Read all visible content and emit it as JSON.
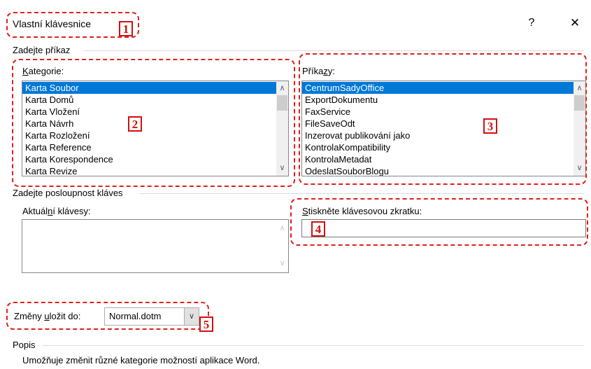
{
  "window": {
    "title": "Vlastní klávesnice",
    "help_label": "?",
    "close_label": "✕"
  },
  "annotations": [
    "1",
    "2",
    "3",
    "4",
    "5"
  ],
  "commands_section": {
    "heading": "Zadejte příkaz",
    "categories_label_pre": "",
    "categories_label_u": "K",
    "categories_label_post": "ategorie:",
    "categories": [
      "Karta Soubor",
      "Karta Domů",
      "Karta Vložení",
      "Karta Návrh",
      "Karta Rozložení",
      "Karta Reference",
      "Karta Korespondence",
      "Karta Revize"
    ],
    "categories_selected": 0,
    "commands_label_pre": "Příka",
    "commands_label_u": "z",
    "commands_label_post": "y:",
    "commands": [
      "CentrumSadyOffice",
      "ExportDokumentu",
      "FaxService",
      "FileSaveOdt",
      "Inzerovat publikování jako",
      "KontrolaKompatibility",
      "KontrolaMetadat",
      "OdeslatSouborBlogu"
    ],
    "commands_selected": 0
  },
  "keys_section": {
    "heading": "Zadejte posloupnost kláves",
    "current_keys_label_pre": "Aktuál",
    "current_keys_label_u": "n",
    "current_keys_label_post": "í klávesy:",
    "press_key_label_pre": "",
    "press_key_label_u": "S",
    "press_key_label_post": "tiskněte klávesovou zkratku:",
    "press_key_value": ""
  },
  "save_in": {
    "label_pre": "Změny ",
    "label_u": "u",
    "label_post": "ložit do:",
    "value": "Normal.dotm"
  },
  "description": {
    "heading": "Popis",
    "text": "Umožňuje změnit různé kategorie možností aplikace Word."
  }
}
